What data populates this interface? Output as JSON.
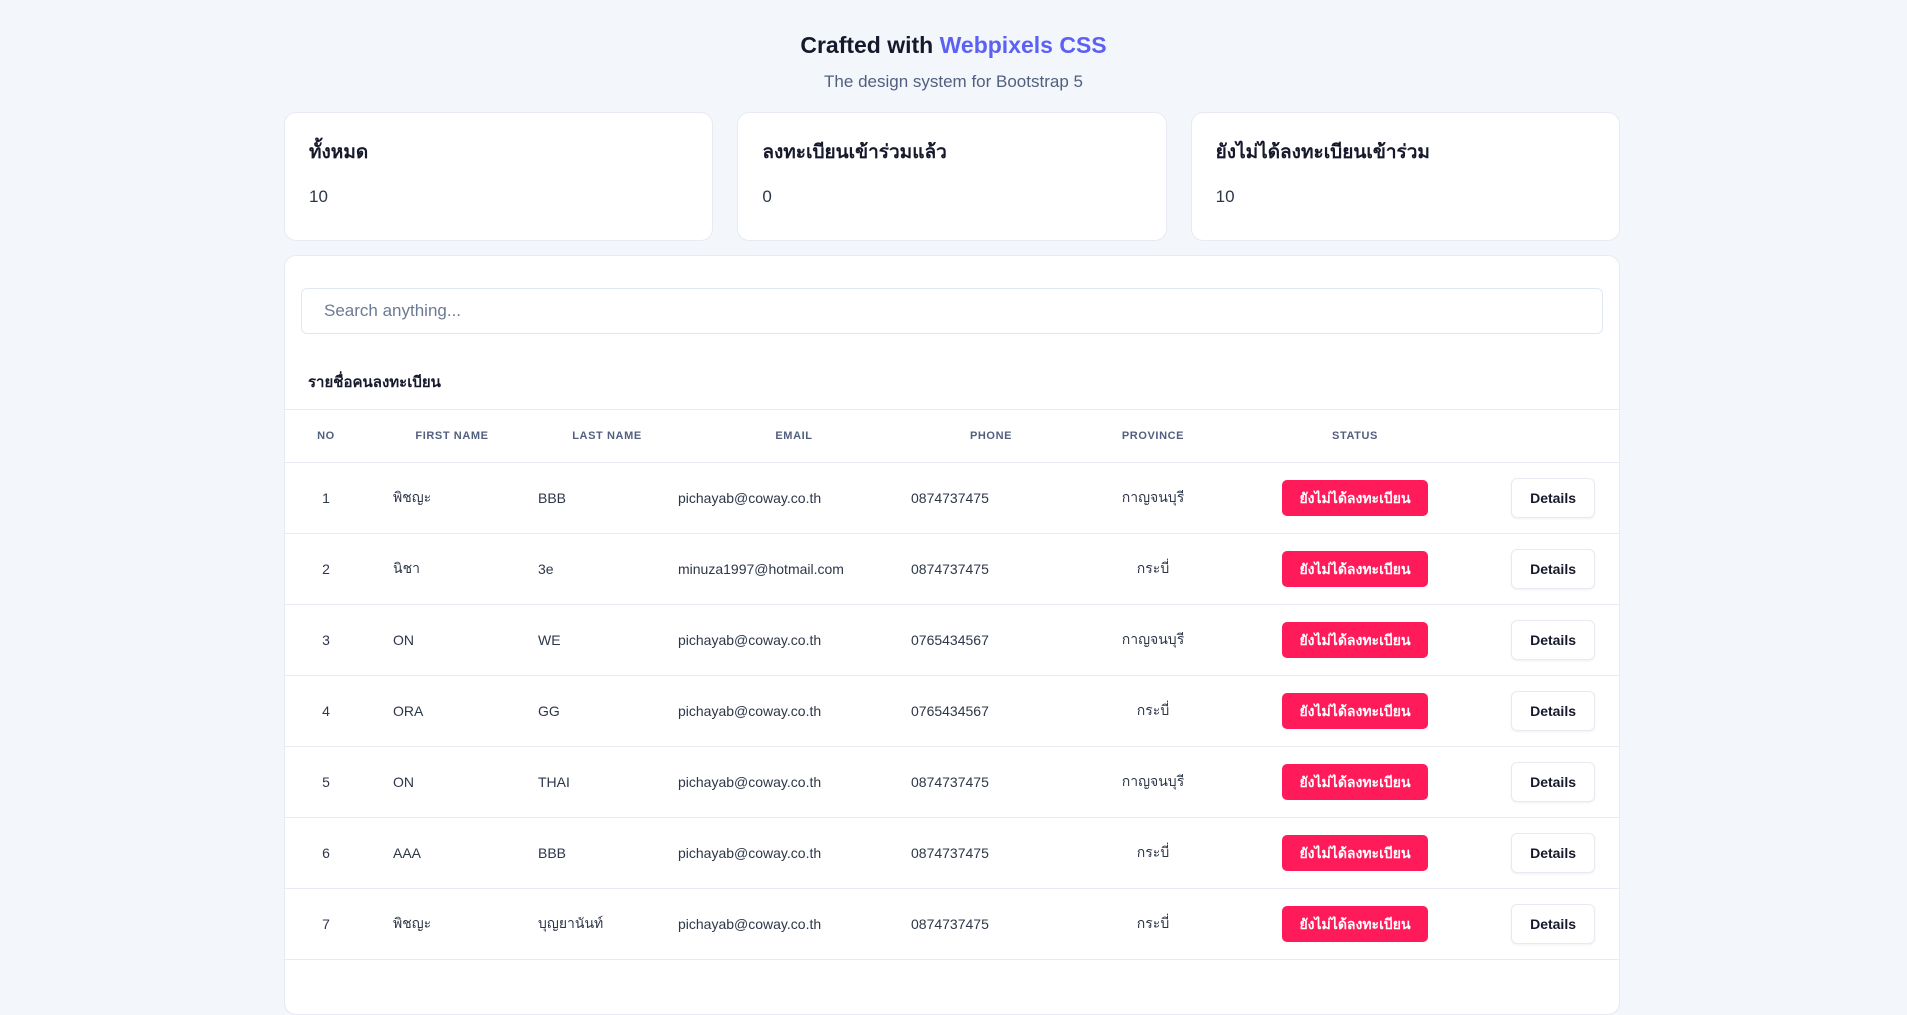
{
  "header": {
    "title_prefix": "Crafted with",
    "title_brand": "Webpixels CSS",
    "subtitle": "The design system for Bootstrap 5"
  },
  "stats": [
    {
      "label": "ทั้งหมด",
      "value": "10"
    },
    {
      "label": "ลงทะเบียนเข้าร่วมแล้ว",
      "value": "0"
    },
    {
      "label": "ยังไม่ได้ลงทะเบียนเข้าร่วม",
      "value": "10"
    }
  ],
  "search": {
    "placeholder": "Search anything..."
  },
  "list_title": "รายชื่อคนลงทะเบียน",
  "table": {
    "headers": [
      "NO",
      "FIRST NAME",
      "LAST NAME",
      "EMAIL",
      "PHONE",
      "PROVINCE",
      "STATUS"
    ],
    "rows": [
      {
        "no": "1",
        "first": "พิชญะ",
        "last": "BBB",
        "email": "pichayab@coway.co.th",
        "phone": "0874737475",
        "province": "กาญจนบุรี",
        "status": "ยังไม่ได้ลงทะเบียน",
        "action": "Details"
      },
      {
        "no": "2",
        "first": "นิชา",
        "last": "3e",
        "email": "minuza1997@hotmail.com",
        "phone": "0874737475",
        "province": "กระบี่",
        "status": "ยังไม่ได้ลงทะเบียน",
        "action": "Details"
      },
      {
        "no": "3",
        "first": "ON",
        "last": "WE",
        "email": "pichayab@coway.co.th",
        "phone": "0765434567",
        "province": "กาญจนบุรี",
        "status": "ยังไม่ได้ลงทะเบียน",
        "action": "Details"
      },
      {
        "no": "4",
        "first": "ORA",
        "last": "GG",
        "email": "pichayab@coway.co.th",
        "phone": "0765434567",
        "province": "กระบี่",
        "status": "ยังไม่ได้ลงทะเบียน",
        "action": "Details"
      },
      {
        "no": "5",
        "first": "ON",
        "last": "THAI",
        "email": "pichayab@coway.co.th",
        "phone": "0874737475",
        "province": "กาญจนบุรี",
        "status": "ยังไม่ได้ลงทะเบียน",
        "action": "Details"
      },
      {
        "no": "6",
        "first": "AAA",
        "last": "BBB",
        "email": "pichayab@coway.co.th",
        "phone": "0874737475",
        "province": "กระบี่",
        "status": "ยังไม่ได้ลงทะเบียน",
        "action": "Details"
      },
      {
        "no": "7",
        "first": "พิชญะ",
        "last": "บุญยานันท์",
        "email": "pichayab@coway.co.th",
        "phone": "0874737475",
        "province": "กระบี่",
        "status": "ยังไม่ได้ลงทะเบียน",
        "action": "Details"
      }
    ]
  },
  "colors": {
    "brand": "#5c60f5",
    "status_badge": "#ff1a5a",
    "background": "#f3f6fb"
  }
}
